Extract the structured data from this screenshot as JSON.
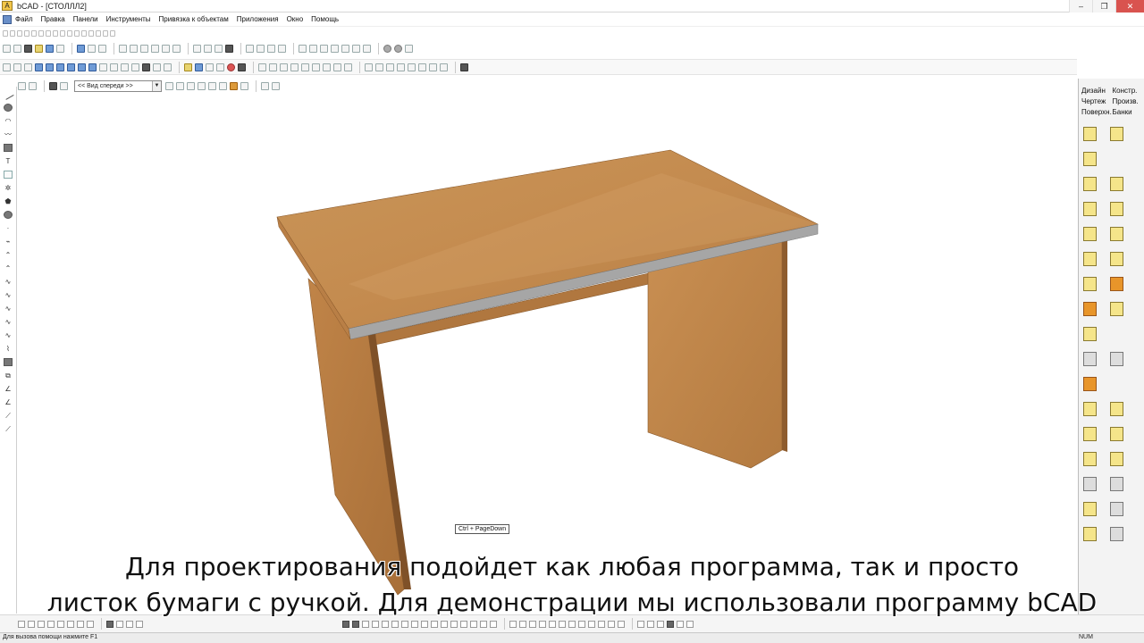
{
  "window": {
    "title": "bCAD - [СТОЛЛЛ2]",
    "app_icon_letter": "A",
    "controls": [
      "–",
      "❐",
      "✕"
    ]
  },
  "menu": {
    "items": [
      "Файл",
      "Правка",
      "Панели",
      "Инструменты",
      "Привязка к объектам",
      "Приложения",
      "Окно",
      "Помощь"
    ]
  },
  "view_toolbar": {
    "view_select_value": "<< Вид спереди >>",
    "view_select_arrow": "▼"
  },
  "right_panel": {
    "tabs": [
      "Дизайн",
      "Констр.",
      "Чертеж",
      "Произв.",
      "Поверхн.",
      "Банки"
    ]
  },
  "tooltip": {
    "text": "Ctrl + PageDown"
  },
  "subtitle": {
    "line1": "Для проектирования подойдет как любая программа, так и просто",
    "line2": "листок бумаги с ручкой. Для демонстрации мы использовали программу bCAD"
  },
  "status": {
    "help_text": "Для вызова помощи нажмите F1",
    "num_indicator": "NUM"
  },
  "colors": {
    "wood_light": "#c9925a",
    "wood_mid": "#b57a45",
    "wood_dark": "#9a6232",
    "edge_grey": "#a9a9a9",
    "close_button": "#d9534f"
  },
  "icons": {
    "left_panel": [
      "line-icon",
      "circle-icon",
      "arc-icon",
      "zigzag-icon",
      "square-icon",
      "text-icon",
      "hatch-icon",
      "gear-icon",
      "polygon-icon",
      "ellipse-icon",
      "point-icon"
    ],
    "right_panel": [
      "panel-icon",
      "panel-corner-icon",
      "frame-icon",
      "cylinder-icon",
      "hinge-icon",
      "drawer-icon",
      "shelf-icon",
      "handle-icon",
      "tools-icon",
      "box-icon",
      "table-icon",
      "cabinet-icon",
      "orange-box-icon",
      "door-icon",
      "column-icon",
      "grid-icon",
      "connector-icon",
      "color-icon",
      "edit-icon",
      "delete-icon",
      "align-left-icon",
      "align-right-icon",
      "distribute-icon",
      "stack-icon",
      "arrow-icon",
      "curve-icon",
      "texture-icon",
      "triangle-icon",
      "material-icon",
      "angle-icon"
    ]
  }
}
